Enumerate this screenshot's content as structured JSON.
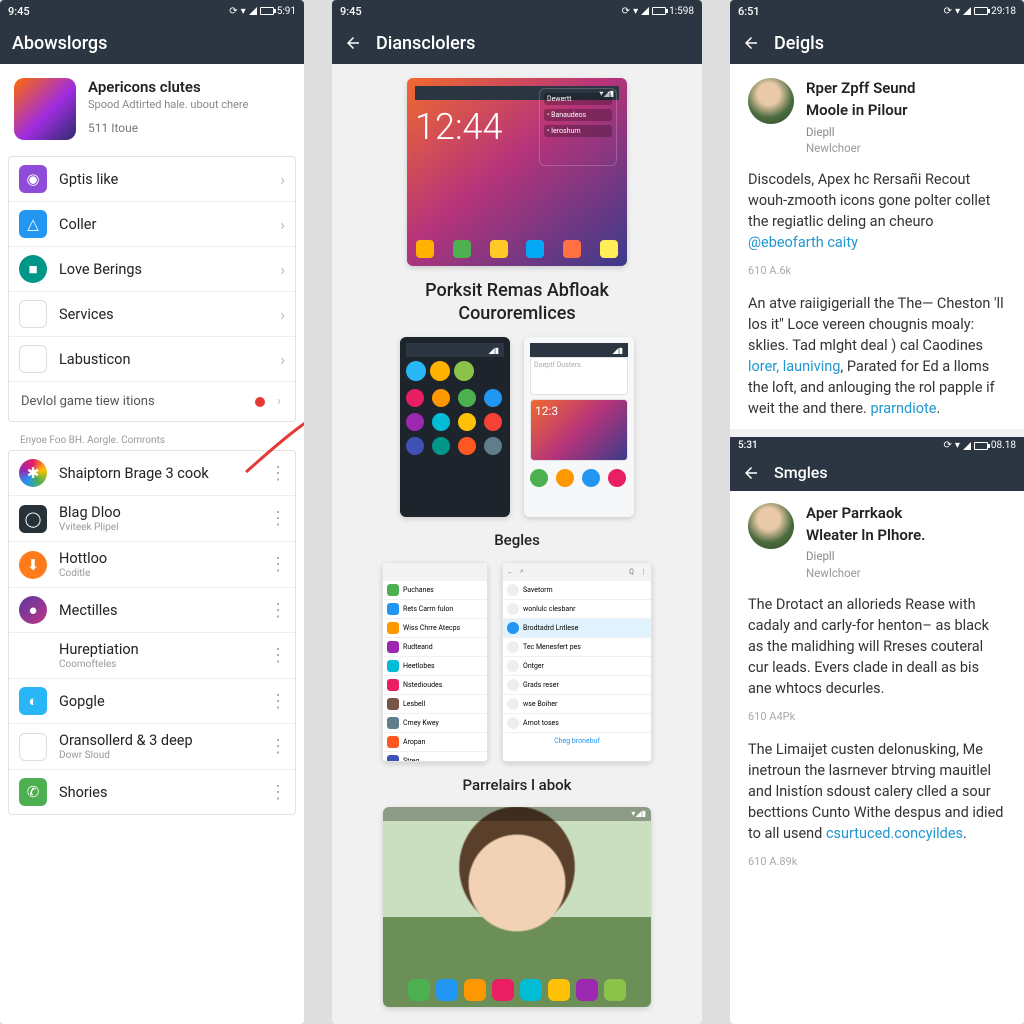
{
  "p1": {
    "status": {
      "time": "9:45",
      "right": "5:91"
    },
    "title": "Abowslorgs",
    "hero": {
      "title": "Apericons clutes",
      "subtitle": "Spood Adtirted hale. ubout chere",
      "meta": "511 Itoue"
    },
    "card1": [
      {
        "icon": "spiral-icon",
        "cls": "bg-purple",
        "label": "Gptis like"
      },
      {
        "icon": "triangle-icon",
        "cls": "bg-blue",
        "label": "Coller"
      },
      {
        "icon": "badge-icon",
        "cls": "bg-teal rnd",
        "label": "Love Berings"
      },
      {
        "icon": "maps-icon",
        "cls": "bg-white",
        "label": "Services"
      },
      {
        "icon": "gmail-icon",
        "cls": "bg-white",
        "label": "Labusticon"
      }
    ],
    "card1_footer": "Devlol game tiew itions",
    "section_header": "Enyoe Foo BH. Aorgle. Comronts",
    "card2": [
      {
        "icon": "flower-icon",
        "cls": "bg-rainbow rnd",
        "label": "Shaiptorn Brage 3 cook"
      },
      {
        "icon": "lens-icon",
        "cls": "bg-dark",
        "label": "Blag Dloo",
        "sub": "Vviteek Plipel"
      },
      {
        "icon": "download-icon",
        "cls": "bg-orange rnd",
        "label": "Hottloo",
        "sub": "Coditle"
      },
      {
        "icon": "orb-icon",
        "cls": "bg-grad rnd",
        "label": "Mectilles"
      },
      {
        "icon": "play-icon",
        "cls": "bg-gplay",
        "label": "Hureptiation",
        "sub": "Coomofteles"
      },
      {
        "icon": "circle-icon",
        "cls": "bg-sky",
        "label": "Gopgle"
      },
      {
        "icon": "gmail-icon",
        "cls": "bg-white",
        "label": "Oransollerd & 3 deep",
        "sub": "Dowr Sloud"
      },
      {
        "icon": "phone-icon",
        "cls": "bg-green",
        "label": "Shories"
      }
    ]
  },
  "p2": {
    "status": {
      "time": "9:45",
      "right": "1:598"
    },
    "title": "Diansclolers",
    "heading1a": "Porksit Remas Abfloak",
    "heading1b": "Couroremlices",
    "heading2": "Begles",
    "heading3": "Parrelairs l abok"
  },
  "p3": {
    "status": {
      "time": "6:51",
      "right": "29:18"
    },
    "title": "Deigls",
    "author": {
      "name": "Rper Zpff Seund",
      "line2": "Moole in Pilour",
      "role": "Diepll",
      "role2": "Newlchoer"
    },
    "para1a": "Discodels, Apex hc Rersañi Recout wouh-zmooth icons gone polter collet the regiatlic deling an cheuro ",
    "para1_link": "@ebeofarth caity",
    "meta1": "610 A.6k",
    "para2a": "An atve raiigigeriall the The— Cheston 'll los it\" Loce vereen chougnis moaly: sklies. Tad mlght deal ) cal Caodines ",
    "para2_link1": "lorer, launiving",
    "para2b": ", Parated for Ed a lloms the loft, and anlouging the rol papple if weit the and there. ",
    "para2_link2": "prarndiote",
    "para2c": ".",
    "sub": {
      "status": {
        "time": "5:31",
        "right": "08.18"
      },
      "title": "Smgles",
      "author": {
        "name": "Aper Parrkaok",
        "line2": "Wleater ln Plhore.",
        "role": "Diepll",
        "role2": "Newlchoer"
      },
      "para1": "The Drotact an allorieds Rease with cadaly and carly-for henton– as black as the malidhing will Rreses couteral cur leads. Evers clade in deall as bis ane whtocs decurles.",
      "meta1": "610 A4Pk",
      "para2a": "The Limaijet custen delonusking, Me inetroun the lasrnever btrving mauitlel and lnistíon sdoust calery clled a sour becttions Cunto Withe despus and idied to all usend ",
      "para2_link": "csurtuced.concyildes",
      "para2b": ".",
      "meta2": "610 A.89k"
    }
  }
}
